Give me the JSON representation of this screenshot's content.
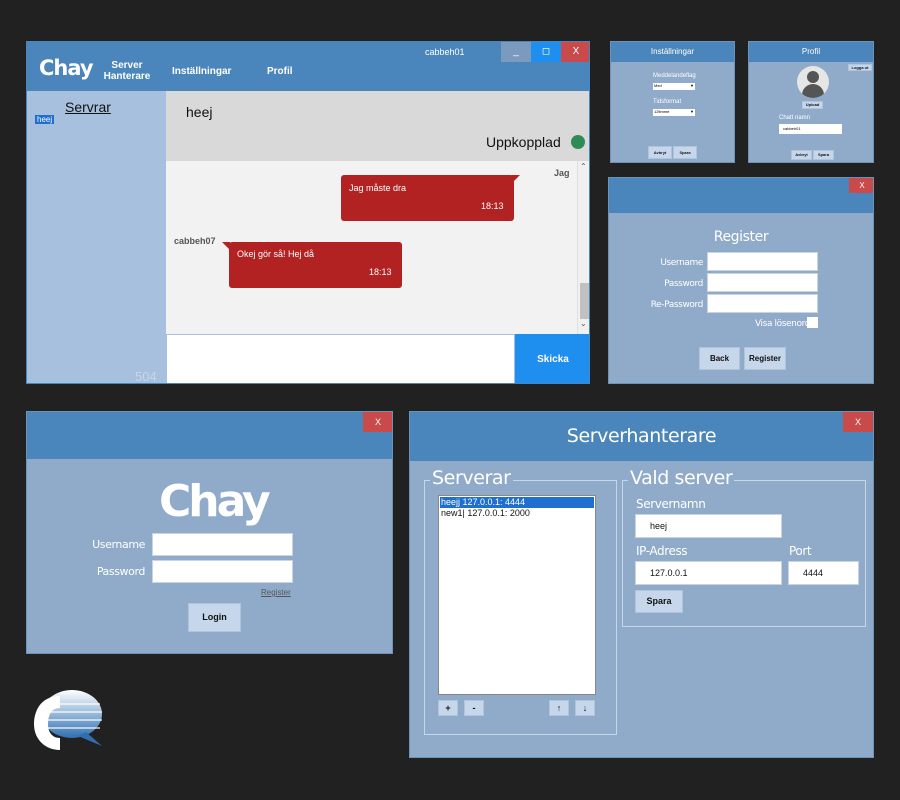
{
  "main_window": {
    "logo": "Chay",
    "nav": [
      "Server\nHanterare",
      "Inställningar",
      "Profil"
    ],
    "username": "cabbeh01",
    "window_buttons": [
      "_",
      "◻",
      "X"
    ],
    "sidebar_title": "Servrar",
    "sidebar_item": "heej",
    "sidebar_counter": "504",
    "server_name": "heej",
    "status": "Uppkopplad",
    "status_color": "#2e8b57",
    "messages": [
      {
        "sender": "Jag",
        "text": "Jag måste dra",
        "time": "18:13",
        "side": "right"
      },
      {
        "sender": "cabbeh07",
        "text": "Okej gör så! Hej då",
        "time": "18:13",
        "side": "left"
      }
    ],
    "send_label": "Skicka",
    "accent": "#1e8fef",
    "bubble_color": "#b22222"
  },
  "settings_window": {
    "title": "Inställningar",
    "notify_label": "Meddelandeflag",
    "notify_value": "Med",
    "time_label": "Tidsformat",
    "time_value": "12timme",
    "cancel": "Avbryt",
    "save": "Spara"
  },
  "profile_window": {
    "title": "Profil",
    "logout": "Logga ut",
    "upload": "Upload",
    "chat_name_label": "Chatt namn",
    "chat_name_value": "cabbeh01",
    "cancel": "Avbryt",
    "save": "Spara"
  },
  "register_window": {
    "close": "X",
    "title": "Register",
    "username_label": "Username",
    "password_label": "Password",
    "repassword_label": "Re-Password",
    "show_password_label": "Visa lösenord",
    "back": "Back",
    "register": "Register"
  },
  "login_window": {
    "close": "X",
    "logo": "Chay",
    "username_label": "Username",
    "password_label": "Password",
    "register_link": "Register",
    "login": "Login"
  },
  "server_manager": {
    "close": "X",
    "title": "Serverhanterare",
    "servers_group": "Serverar",
    "servers": [
      "heejj 127.0.0.1: 4444",
      "new1| 127.0.0.1: 2000"
    ],
    "list_buttons": [
      "+",
      "-",
      "↑",
      "↓"
    ],
    "selected_group": "Vald server",
    "server_name_label": "Servernamn",
    "server_name_value": "heej",
    "ip_label": "IP-Adress",
    "ip_value": "127.0.0.1",
    "port_label": "Port",
    "port_value": "4444",
    "save": "Spara"
  }
}
